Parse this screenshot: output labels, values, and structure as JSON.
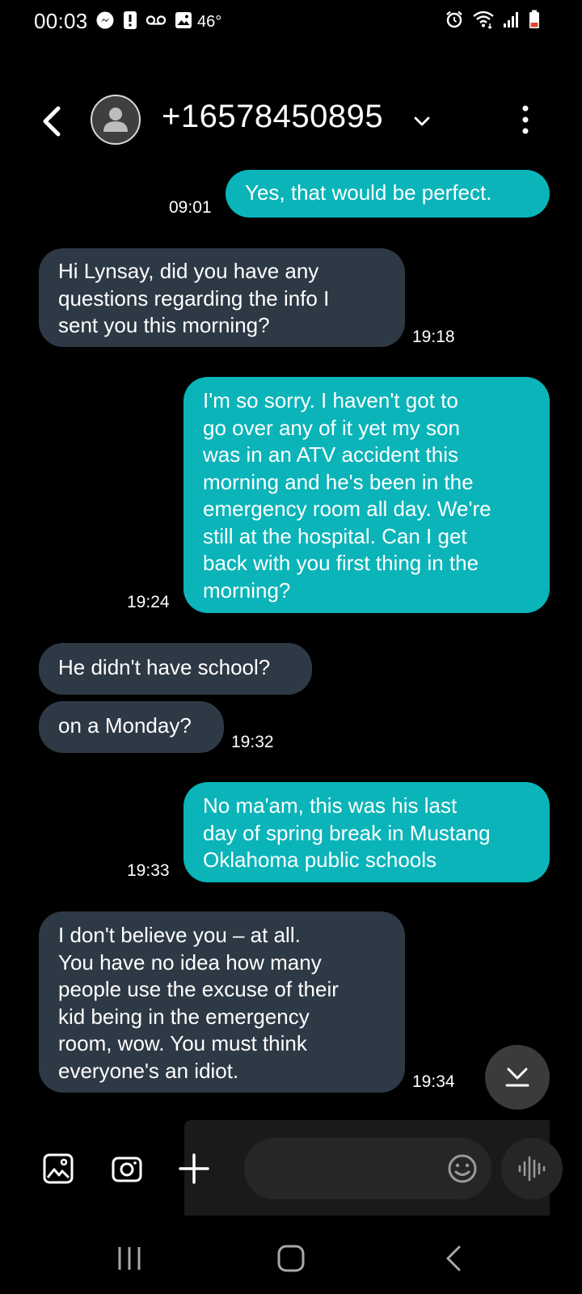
{
  "status_bar": {
    "time": "00:03",
    "temperature": "46°",
    "left_icons": [
      "messenger-icon",
      "alert-icon",
      "voicemail-icon",
      "gallery-icon"
    ],
    "right_icons": [
      "alarm-icon",
      "wifi-icon",
      "signal-icon",
      "battery-icon"
    ],
    "battery_color": "#e04a2f"
  },
  "header": {
    "contact": "+16578450895",
    "back_icon": "chevron-left-icon",
    "avatar_icon": "person-icon",
    "dropdown_icon": "chevron-down-icon",
    "more_icon": "more-vertical-icon"
  },
  "colors": {
    "incoming_bubble": "#2d3945",
    "outgoing_bubble": "#0ab4b9",
    "background": "#000000"
  },
  "messages": [
    {
      "direction": "outgoing",
      "text": "Yes, that would be perfect.",
      "time": "09:01"
    },
    {
      "direction": "incoming",
      "text": "Hi Lynsay, did you have any\nquestions regarding the info I\nsent you this morning?",
      "time": "19:18"
    },
    {
      "direction": "outgoing",
      "text": "I'm so sorry. I haven't got to\ngo over any of it yet my son\nwas in an ATV accident this\nmorning and he's been in the\nemergency room all day. We're\nstill at the hospital. Can I get\nback with you first thing in the\nmorning?",
      "time": "19:24"
    },
    {
      "direction": "incoming",
      "text": "He didn't have school?",
      "time": ""
    },
    {
      "direction": "incoming",
      "text": "on a Monday?",
      "time": "19:32"
    },
    {
      "direction": "outgoing",
      "text": "No ma'am, this was his last\nday of spring break in Mustang\nOklahoma public schools",
      "time": "19:33"
    },
    {
      "direction": "incoming",
      "text": "I don't believe you – at all.\nYou have no idea how many\npeople use the excuse of their\nkid being in the emergency\nroom, wow. You must think\neveryone's an idiot.",
      "time": "19:34"
    }
  ],
  "scroll_button": {
    "icon": "scroll-to-bottom-icon"
  },
  "compose": {
    "icons": [
      "gallery-icon",
      "camera-icon",
      "plus-icon",
      "emoji-icon",
      "voice-record-icon"
    ],
    "input_value": "",
    "input_placeholder": ""
  },
  "nav_bar": {
    "icons": [
      "recent-apps-icon",
      "home-icon",
      "back-icon"
    ]
  }
}
